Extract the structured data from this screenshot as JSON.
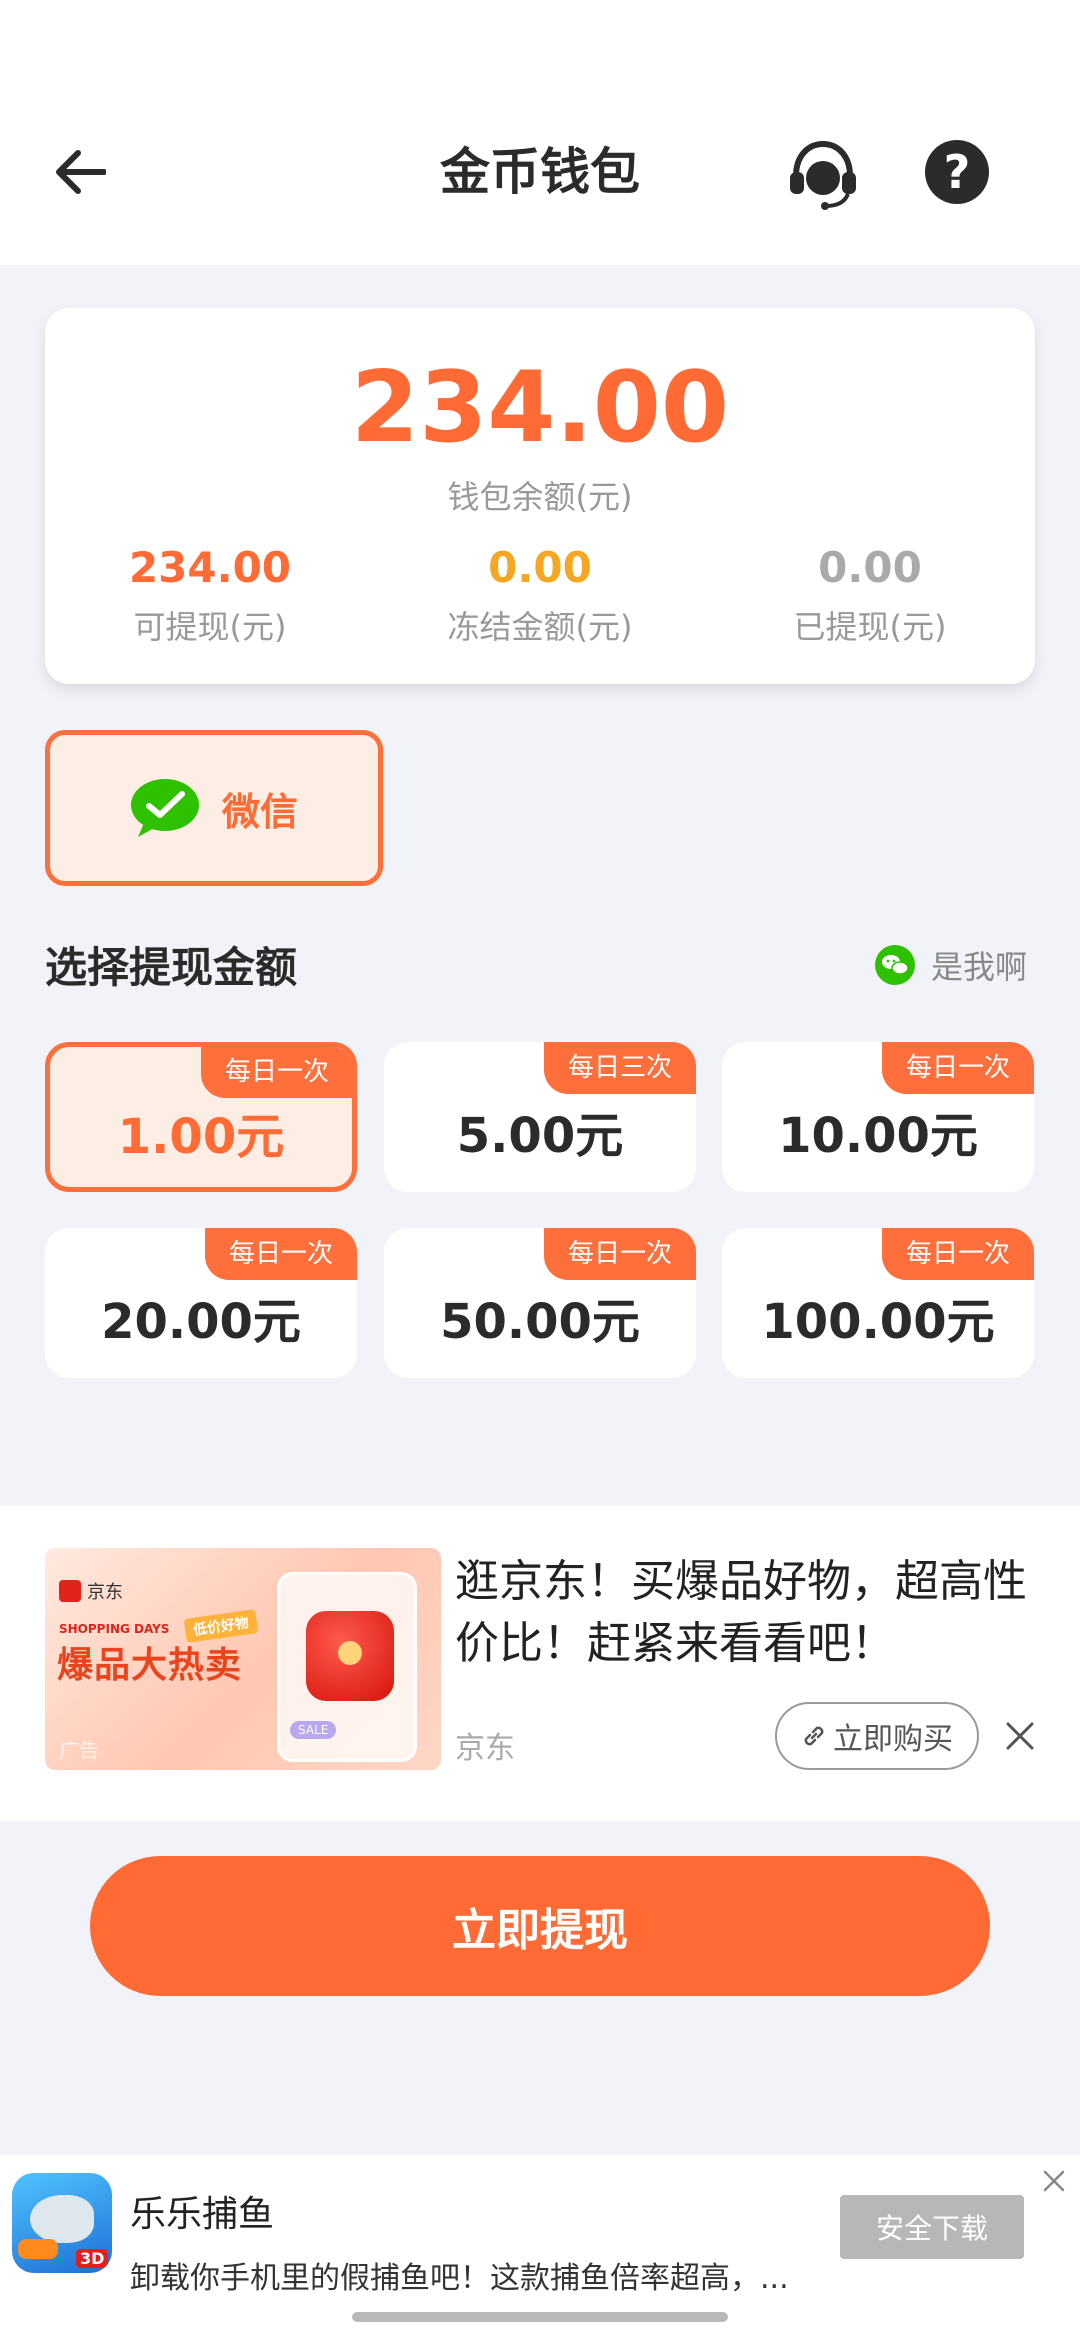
{
  "header": {
    "title": "金币钱包",
    "back_icon": "arrow-left-icon",
    "support_icon": "headset-icon",
    "help_icon": "question-circle-icon",
    "help_glyph": "?"
  },
  "balance": {
    "amount": "234.00",
    "label": "钱包余额(元)",
    "stats": [
      {
        "value": "234.00",
        "label": "可提现(元)",
        "color": "#ff6a35"
      },
      {
        "value": "0.00",
        "label": "冻结金额(元)",
        "color": "#f5a623"
      },
      {
        "value": "0.00",
        "label": "已提现(元)",
        "color": "#aaaaaa"
      }
    ]
  },
  "method": {
    "label": "微信",
    "icon": "wechat-icon"
  },
  "withdraw_section": {
    "title": "选择提现金额",
    "account_name": "是我啊",
    "options": [
      {
        "amount": "1.00元",
        "tag": "每日一次",
        "selected": true
      },
      {
        "amount": "5.00元",
        "tag": "每日三次",
        "selected": false
      },
      {
        "amount": "10.00元",
        "tag": "每日一次",
        "selected": false
      },
      {
        "amount": "20.00元",
        "tag": "每日一次",
        "selected": false
      },
      {
        "amount": "50.00元",
        "tag": "每日一次",
        "selected": false
      },
      {
        "amount": "100.00元",
        "tag": "每日一次",
        "selected": false
      }
    ]
  },
  "ad": {
    "image_brand": "京东",
    "image_tagline": "SHOPPING DAYS",
    "image_headline": "爆品大热卖",
    "image_badge": "低价好物",
    "image_sale": "SALE",
    "image_ad_mark": "广告",
    "text": "逛京东！买爆品好物，超高性价比！赶紧来看看吧！",
    "source": "京东",
    "buy_label": "立即购买"
  },
  "withdraw_button": "立即提现",
  "bottom_ad": {
    "game_name": "乐乐捕鱼",
    "description": "卸载你手机里的假捕鱼吧！这款捕鱼倍率超高，...",
    "download_label": "安全下载",
    "icon_badge": "3D"
  },
  "colors": {
    "accent": "#ff6a35",
    "wechat_green": "#2dc100"
  }
}
